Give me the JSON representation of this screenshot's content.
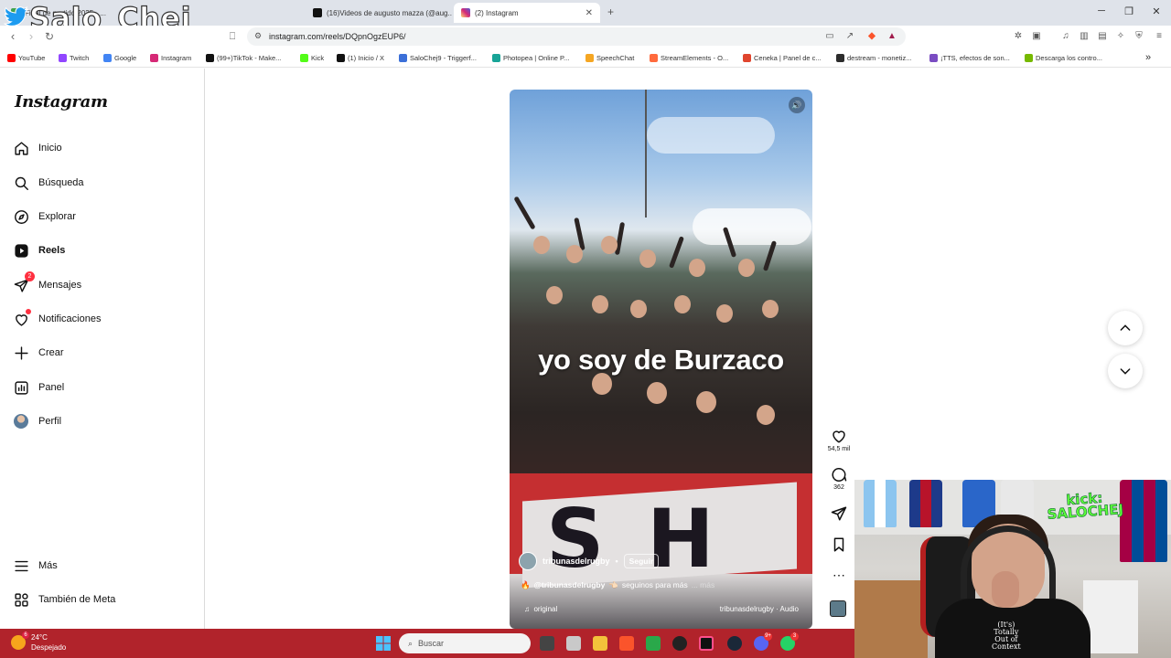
{
  "browser": {
    "tabs": [
      {
        "label": "Final de partido 2025 - ...",
        "active": false,
        "favicon_color": "#3fa34d"
      },
      {
        "label": "(16)Videos de augusto mazza (@aug...",
        "active": false,
        "favicon_color": "#111111"
      },
      {
        "label": "(2) Instagram",
        "active": true,
        "favicon_color": "#d62976"
      }
    ],
    "new_tab": "+",
    "url": "instagram.com/reels/DQpnOgzEUP6/",
    "bookmarks": [
      {
        "label": "YouTube",
        "color": "#ff0000"
      },
      {
        "label": "Twitch",
        "color": "#9146ff"
      },
      {
        "label": "Google",
        "color": "#4285f4"
      },
      {
        "label": "Instagram",
        "color": "#d62976"
      },
      {
        "label": "(99+)TikTok - Make...",
        "color": "#111111"
      },
      {
        "label": "Kick",
        "color": "#53fc18"
      },
      {
        "label": "(1) Inicio / X",
        "color": "#111111"
      },
      {
        "label": "SaloChej9 - Triggerf...",
        "color": "#3b6fd8"
      },
      {
        "label": "Photopea | Online P...",
        "color": "#18a497"
      },
      {
        "label": "SpeechChat",
        "color": "#f5a623"
      },
      {
        "label": "StreamElements - O...",
        "color": "#ff6a3d"
      },
      {
        "label": "Ceneka | Panel de c...",
        "color": "#e0452e"
      },
      {
        "label": "destream - monetiz...",
        "color": "#2c2c2c"
      },
      {
        "label": "¡TTS, efectos de son...",
        "color": "#7a4cc2"
      },
      {
        "label": "Descarga los contro...",
        "color": "#76b900"
      }
    ],
    "more_bookmarks": "»"
  },
  "sidebar": {
    "logo": "Instagram",
    "items": [
      {
        "label": "Inicio",
        "icon": "home-icon"
      },
      {
        "label": "Búsqueda",
        "icon": "search-icon"
      },
      {
        "label": "Explorar",
        "icon": "compass-icon"
      },
      {
        "label": "Reels",
        "icon": "reels-icon",
        "active": true
      },
      {
        "label": "Mensajes",
        "icon": "messenger-icon",
        "badge": "2"
      },
      {
        "label": "Notificaciones",
        "icon": "heart-icon"
      },
      {
        "label": "Crear",
        "icon": "plus-icon"
      },
      {
        "label": "Panel",
        "icon": "dashboard-icon"
      },
      {
        "label": "Perfil",
        "icon": "avatar"
      }
    ],
    "bottom": [
      {
        "label": "Más",
        "icon": "menu-icon"
      },
      {
        "label": "También de Meta",
        "icon": "meta-grid-icon"
      }
    ]
  },
  "reel": {
    "caption_overlay": "yo soy de Burzaco",
    "username": "tribunasdelrugby",
    "follow_label": "Seguir",
    "description_handle": "@tribunasdelrugby",
    "description_text": "seguinos para más",
    "description_more": "... más",
    "audio_left": "original",
    "audio_right": "tribunasdelrugby · Audio",
    "likes": "54,5 mil",
    "comments": "362"
  },
  "taskbar": {
    "temperature": "24°C",
    "weather": "Despejado",
    "weather_badge": "6",
    "search_placeholder": "Buscar",
    "discord_badge": "9+",
    "whatsapp_badge": "3"
  },
  "overlay": {
    "streamer_name": "Salo_Chej",
    "kick_line1": "kick:",
    "kick_line2": "SALOCHEJ",
    "shirt_line1": "(It's)",
    "shirt_line2": "Totally",
    "shirt_line3": "Out of",
    "shirt_line4": "Context"
  },
  "colors": {
    "taskbar": "#b1232b",
    "notification_red": "#ff3040",
    "kick_green": "#5dff3a"
  }
}
